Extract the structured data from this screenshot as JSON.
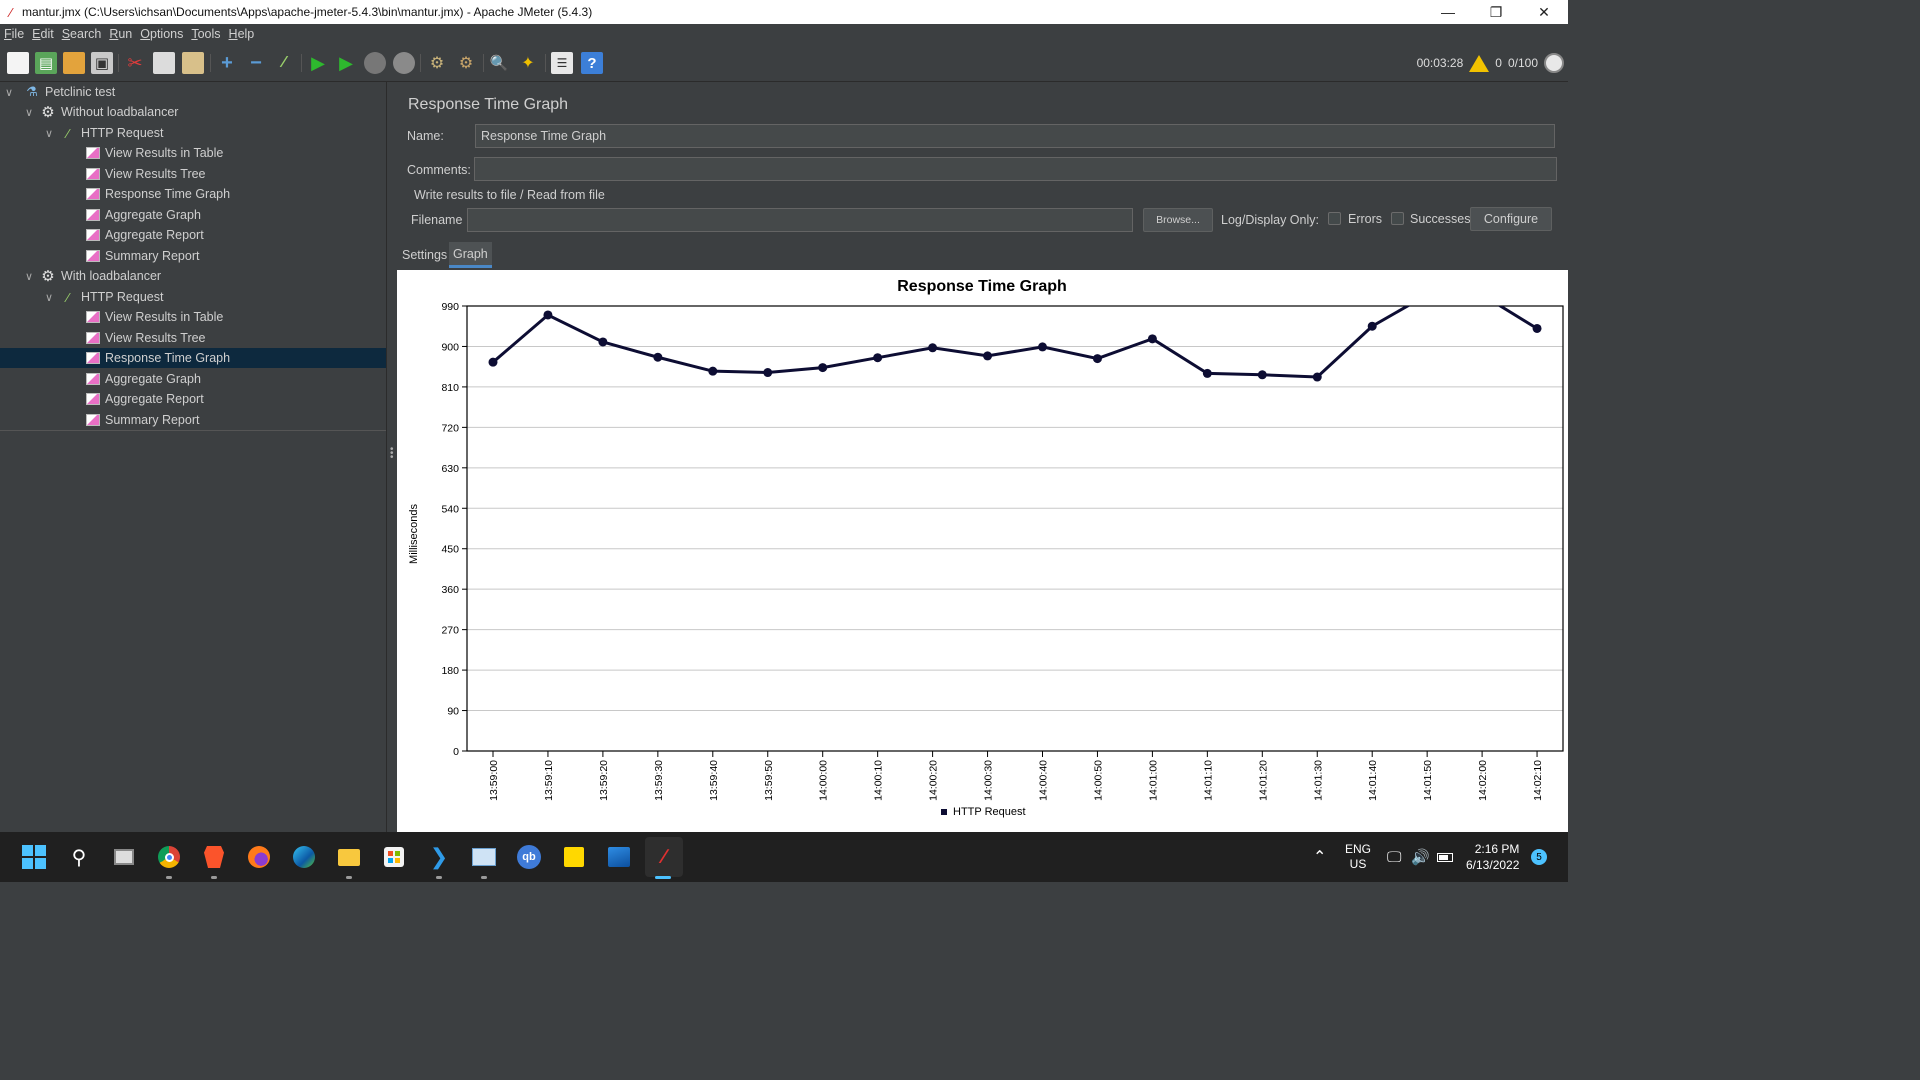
{
  "window": {
    "title": "mantur.jmx (C:\\Users\\ichsan\\Documents\\Apps\\apache-jmeter-5.4.3\\bin\\mantur.jmx) - Apache JMeter (5.4.3)"
  },
  "menu": [
    {
      "mnemonic": "F",
      "rest": "ile"
    },
    {
      "mnemonic": "E",
      "rest": "dit"
    },
    {
      "mnemonic": "S",
      "rest": "earch"
    },
    {
      "mnemonic": "R",
      "rest": "un"
    },
    {
      "mnemonic": "O",
      "rest": "ptions"
    },
    {
      "mnemonic": "T",
      "rest": "ools"
    },
    {
      "mnemonic": "H",
      "rest": "elp"
    }
  ],
  "toolbar": {
    "elapsed": "00:03:28",
    "warnings": "0",
    "threads": "0/100",
    "icons": [
      "new-icon",
      "templates-icon",
      "open-icon",
      "save-icon",
      "cut-icon",
      "copy-icon",
      "paste-icon",
      "expand-icon",
      "collapse-icon",
      "toggle-icon",
      "start-icon",
      "start-no-pause-icon",
      "stop-icon",
      "shutdown-icon",
      "clear-icon",
      "clear-all-icon",
      "search-icon",
      "reset-search-icon",
      "function-helper-icon",
      "help-icon"
    ]
  },
  "tree": {
    "items": [
      {
        "label": "Petclinic test",
        "icon": "flask-icon",
        "level": 0,
        "expandable": true
      },
      {
        "label": "Without loadbalancer",
        "icon": "gear-icon",
        "level": 1,
        "expandable": true
      },
      {
        "label": "HTTP Request",
        "icon": "pipette-icon",
        "level": 2,
        "expandable": true
      },
      {
        "label": "View Results in Table",
        "icon": "graph-icon",
        "level": 3
      },
      {
        "label": "View Results Tree",
        "icon": "graph-icon",
        "level": 3
      },
      {
        "label": "Response Time Graph",
        "icon": "graph-icon",
        "level": 3
      },
      {
        "label": "Aggregate Graph",
        "icon": "graph-icon",
        "level": 3
      },
      {
        "label": "Aggregate Report",
        "icon": "graph-icon",
        "level": 3
      },
      {
        "label": "Summary Report",
        "icon": "graph-icon",
        "level": 3
      },
      {
        "label": "With loadbalancer",
        "icon": "gear-icon",
        "level": 1,
        "expandable": true
      },
      {
        "label": "HTTP Request",
        "icon": "pipette-icon",
        "level": 2,
        "expandable": true
      },
      {
        "label": "View Results in Table",
        "icon": "graph-icon",
        "level": 3
      },
      {
        "label": "View Results Tree",
        "icon": "graph-icon",
        "level": 3
      },
      {
        "label": "Response Time Graph",
        "icon": "graph-icon",
        "level": 3,
        "selected": true
      },
      {
        "label": "Aggregate Graph",
        "icon": "graph-icon",
        "level": 3
      },
      {
        "label": "Aggregate Report",
        "icon": "graph-icon",
        "level": 3
      },
      {
        "label": "Summary Report",
        "icon": "graph-icon",
        "level": 3
      }
    ]
  },
  "panel": {
    "title": "Response Time Graph",
    "name_label": "Name:",
    "name_value": "Response Time Graph",
    "comments_label": "Comments:",
    "comments_value": "",
    "file_section": "Write results to file / Read from file",
    "filename_label": "Filename",
    "filename_value": "",
    "browse_label": "Browse...",
    "log_display_label": "Log/Display Only:",
    "errors_label": "Errors",
    "successes_label": "Successes",
    "configure_label": "Configure",
    "tabs": [
      {
        "label": "Settings",
        "active": false
      },
      {
        "label": "Graph",
        "active": true
      }
    ]
  },
  "chart_data": {
    "type": "line",
    "title": "Response Time Graph",
    "xlabel": "",
    "ylabel": "Milliseconds",
    "ylim": [
      0,
      990
    ],
    "yticks": [
      0,
      90,
      180,
      270,
      360,
      450,
      540,
      630,
      720,
      810,
      900,
      990
    ],
    "categories": [
      "13:59:00",
      "13:59:10",
      "13:59:20",
      "13:59:30",
      "13:59:40",
      "13:59:50",
      "14:00:00",
      "14:00:10",
      "14:00:20",
      "14:00:30",
      "14:00:40",
      "14:00:50",
      "14:01:00",
      "14:01:10",
      "14:01:20",
      "14:01:30",
      "14:01:40",
      "14:01:50",
      "14:02:00",
      "14:02:10"
    ],
    "series": [
      {
        "name": "HTTP Request",
        "color": "#0d0d33",
        "values": [
          865,
          970,
          910,
          876,
          845,
          842,
          853,
          875,
          897,
          879,
          899,
          873,
          917,
          840,
          837,
          832,
          945,
          1015,
          1015,
          940
        ],
        "hidden_points": [
          17,
          18
        ]
      }
    ],
    "legend": "bottom",
    "grid": true
  },
  "taskbar": {
    "apps": [
      "start-icon",
      "search-icon",
      "task-view-icon",
      "chrome-icon",
      "brave-icon",
      "firefox-icon",
      "edge-icon",
      "file-explorer-icon",
      "store-icon",
      "vscode-icon",
      "resource-monitor-icon",
      "qbittorrent-icon",
      "sticky-notes-icon",
      "photos-icon",
      "jmeter-icon"
    ],
    "lang_top": "ENG",
    "lang_bottom": "US",
    "time": "2:16 PM",
    "date": "6/13/2022",
    "notification_count": "5"
  }
}
